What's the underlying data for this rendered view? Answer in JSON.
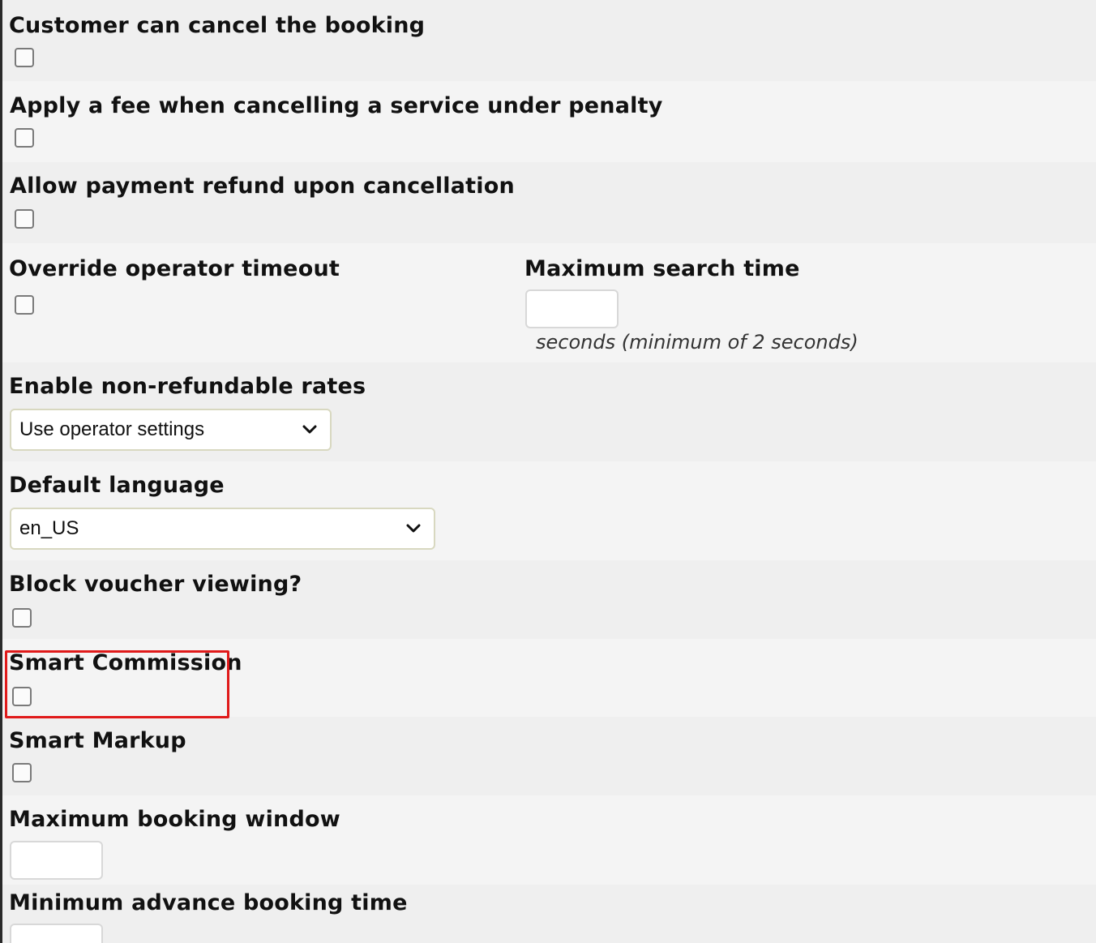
{
  "settings": {
    "customer_cancel": {
      "label": "Customer can cancel the booking"
    },
    "cancel_fee": {
      "label": "Apply a fee when cancelling a service under penalty"
    },
    "refund": {
      "label": "Allow payment refund upon cancellation"
    },
    "override_timeout": {
      "label": "Override operator timeout"
    },
    "max_search_time": {
      "label": "Maximum search time",
      "value": "",
      "hint": "seconds (minimum of 2 seconds)"
    },
    "non_refundable": {
      "label": "Enable non-refundable rates",
      "selected": "Use operator settings"
    },
    "default_language": {
      "label": "Default language",
      "selected": "en_US"
    },
    "block_voucher": {
      "label": "Block voucher viewing?"
    },
    "smart_commission": {
      "label": "Smart Commission"
    },
    "smart_markup": {
      "label": "Smart Markup"
    },
    "max_booking_window": {
      "label": "Maximum booking window",
      "value": ""
    },
    "min_advance_booking": {
      "label": "Minimum advance booking time",
      "value": ""
    }
  },
  "colors": {
    "highlight": "#e01a1a",
    "row_alt": "#efefef",
    "row_base": "#f4f4f4"
  }
}
